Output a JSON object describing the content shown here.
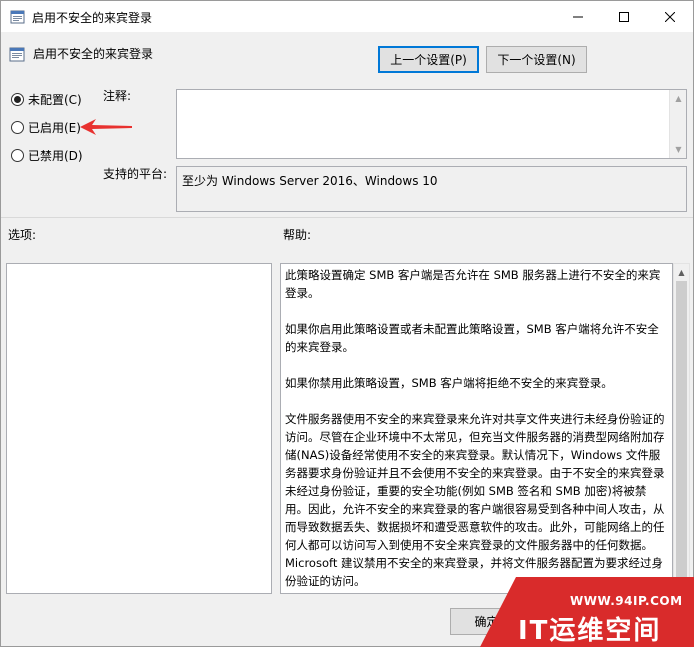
{
  "window": {
    "title": "启用不安全的来宾登录",
    "controls": {
      "minimize": "minimize-icon",
      "maximize": "maximize-icon",
      "close": "close-icon"
    }
  },
  "header": {
    "title": "启用不安全的来宾登录",
    "prev_button": "上一个设置(P)",
    "next_button": "下一个设置(N)"
  },
  "radios": {
    "selected": "not_configured",
    "items": [
      {
        "id": "not_configured",
        "label": "未配置(C)"
      },
      {
        "id": "enabled",
        "label": "已启用(E)"
      },
      {
        "id": "disabled",
        "label": "已禁用(D)"
      }
    ]
  },
  "comment": {
    "label": "注释:",
    "value": ""
  },
  "platform": {
    "label": "支持的平台:",
    "value": "至少为 Windows Server 2016、Windows 10"
  },
  "options": {
    "label": "选项:"
  },
  "help": {
    "label": "帮助:",
    "paragraphs": [
      "此策略设置确定 SMB 客户端是否允许在 SMB 服务器上进行不安全的来宾登录。",
      "如果你启用此策略设置或者未配置此策略设置，SMB 客户端将允许不安全的来宾登录。",
      "如果你禁用此策略设置，SMB 客户端将拒绝不安全的来宾登录。",
      "文件服务器使用不安全的来宾登录来允许对共享文件夹进行未经身份验证的访问。尽管在企业环境中不太常见，但充当文件服务器的消费型网络附加存储(NAS)设备经常使用不安全的来宾登录。默认情况下，Windows 文件服务器要求身份验证并且不会使用不安全的来宾登录。由于不安全的来宾登录未经过身份验证，重要的安全功能(例如 SMB 签名和 SMB 加密)将被禁用。因此，允许不安全的来宾登录的客户端很容易受到各种中间人攻击，从而导致数据丢失、数据损坏和遭受恶意软件的攻击。此外，可能网络上的任何人都可以访问写入到使用不安全来宾登录的文件服务器中的任何数据。Microsoft 建议禁用不安全的来宾登录，并将文件服务器配置为要求经过身份验证的访问。"
    ]
  },
  "footer": {
    "ok_button": "确定"
  },
  "watermark": {
    "url": "WWW.94IP.COM",
    "brand": "IT运维空间"
  },
  "colors": {
    "accent": "#0078d7",
    "arrow": "#e8312f",
    "watermark": "#d92b2b"
  }
}
